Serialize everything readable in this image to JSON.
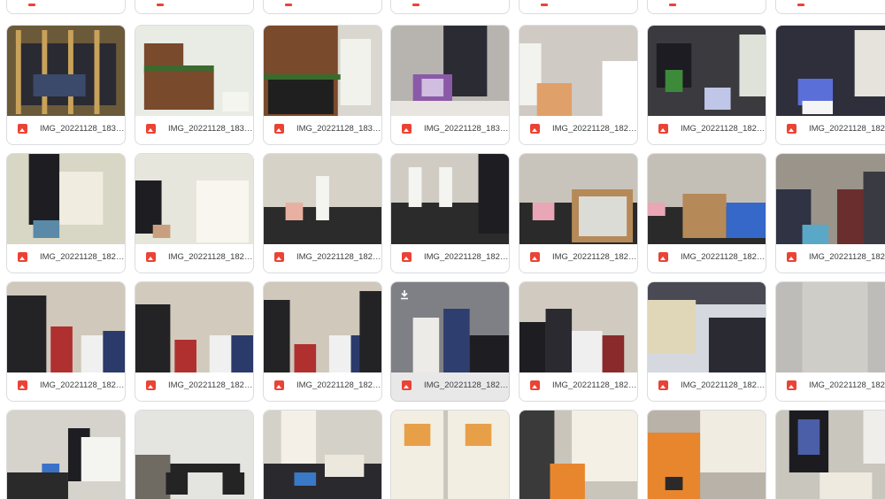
{
  "icons": {
    "file_type": "image-file-icon",
    "download": "download-icon"
  },
  "colors": {
    "image_icon": "#ea4335",
    "card_border": "#dadce0",
    "selected_bg": "#e8e8e8"
  },
  "rows": [
    [
      {
        "name": "IMG_20221128_1833...",
        "theme": "cage"
      },
      {
        "name": "IMG_20221128_1833...",
        "theme": "box"
      },
      {
        "name": "IMG_20221128_1833...",
        "theme": "boxbig"
      },
      {
        "name": "IMG_20221128_1832...",
        "theme": "purple"
      },
      {
        "name": "IMG_20221128_1829...",
        "theme": "lamp"
      },
      {
        "name": "IMG_20221128_1828...",
        "theme": "dark"
      },
      {
        "name": "IMG_20221128_1828...",
        "theme": "blue"
      }
    ],
    [
      {
        "name": "IMG_20221128_1828...",
        "theme": "person"
      },
      {
        "name": "IMG_20221128_1828...",
        "theme": "person2"
      },
      {
        "name": "IMG_20221128_1827...",
        "theme": "easel"
      },
      {
        "name": "IMG_20221128_1827...",
        "theme": "easel2"
      },
      {
        "name": "IMG_20221128_1827...",
        "theme": "frame"
      },
      {
        "name": "IMG_20221128_1827...",
        "theme": "frame2"
      },
      {
        "name": "IMG_20221128_1827...",
        "theme": "crowd"
      }
    ],
    [
      {
        "name": "IMG_20221128_1826...",
        "theme": "people"
      },
      {
        "name": "IMG_20221128_1826...",
        "theme": "people2"
      },
      {
        "name": "IMG_20221128_1826...",
        "theme": "people3"
      },
      {
        "name": "IMG_20221128_1826...",
        "theme": "group",
        "selected": true,
        "download": true
      },
      {
        "name": "IMG_20221128_1826...",
        "theme": "group2"
      },
      {
        "name": "IMG_20221128_1826...",
        "theme": "hall"
      },
      {
        "name": "IMG_20221128_1826...",
        "theme": "blur"
      }
    ],
    [
      {
        "name": "",
        "theme": "desk"
      },
      {
        "name": "",
        "theme": "bike"
      },
      {
        "name": "",
        "theme": "mouse"
      },
      {
        "name": "",
        "theme": "poster"
      },
      {
        "name": "",
        "theme": "pencil"
      },
      {
        "name": "",
        "theme": "pencil2"
      },
      {
        "name": "",
        "theme": "black"
      }
    ]
  ]
}
